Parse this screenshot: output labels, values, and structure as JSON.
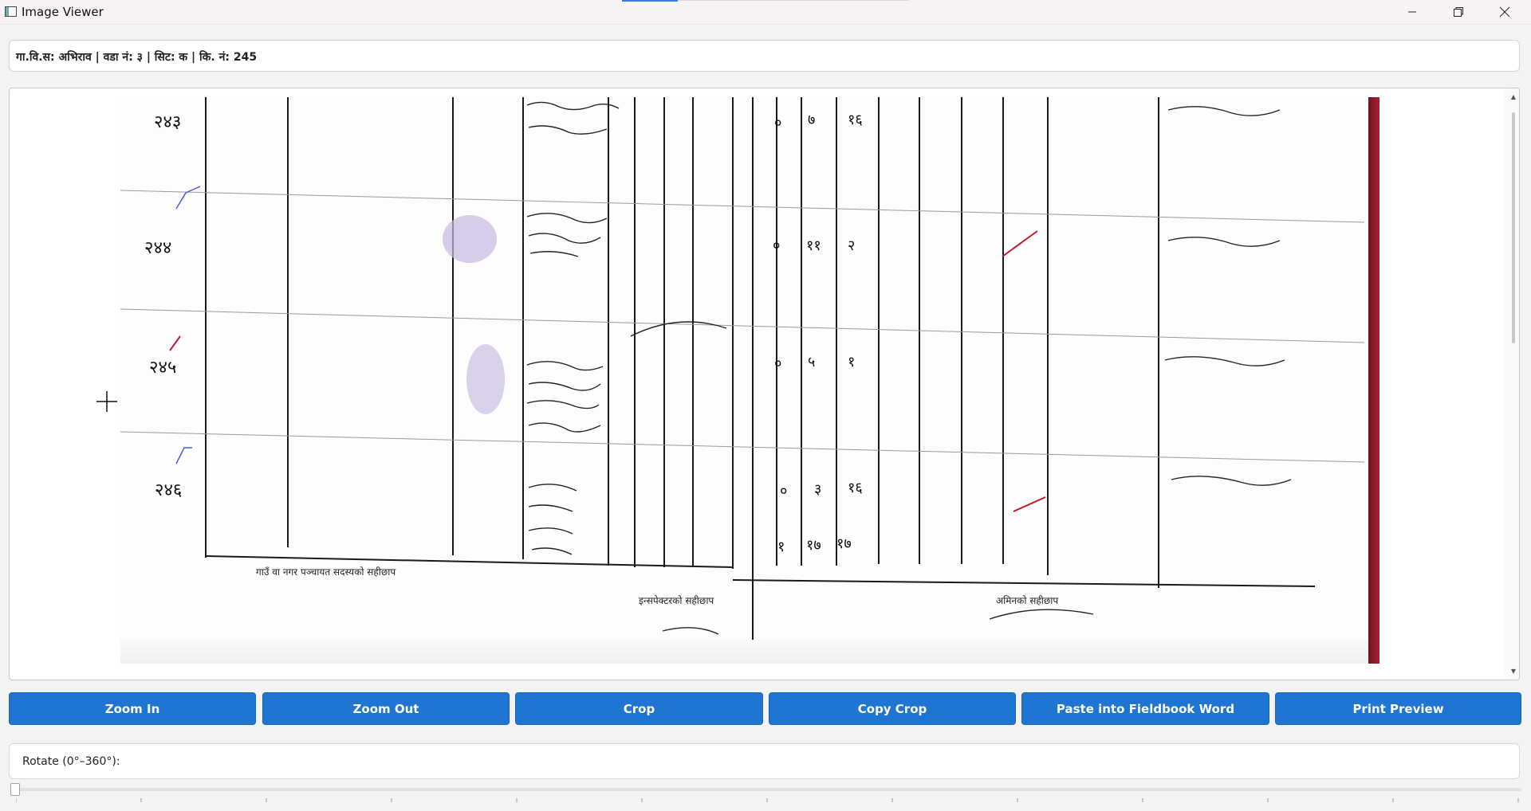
{
  "window": {
    "title": "Image Viewer",
    "controls": [
      "minimize-icon",
      "restore-icon",
      "close-icon"
    ]
  },
  "info": {
    "text": "गा.वि.स: अभिराव | वडा नं: ३ | सिट: क | कि. नं: 245"
  },
  "viewer": {
    "image_description_icon": "scanned-fieldbook-page",
    "cursor": "crosshair-icon"
  },
  "toolbar": {
    "zoom_in": "Zoom In",
    "zoom_out": "Zoom Out",
    "crop": "Crop",
    "copy_crop": "Copy Crop",
    "paste_fieldbook": "Paste into Fieldbook Word",
    "print_preview": "Print Preview"
  },
  "rotate": {
    "label": "Rotate (0°–360°):",
    "value": 0,
    "min": 0,
    "max": 360
  },
  "colors": {
    "button_blue": "#1f76d2",
    "button_text": "#ffffff"
  }
}
